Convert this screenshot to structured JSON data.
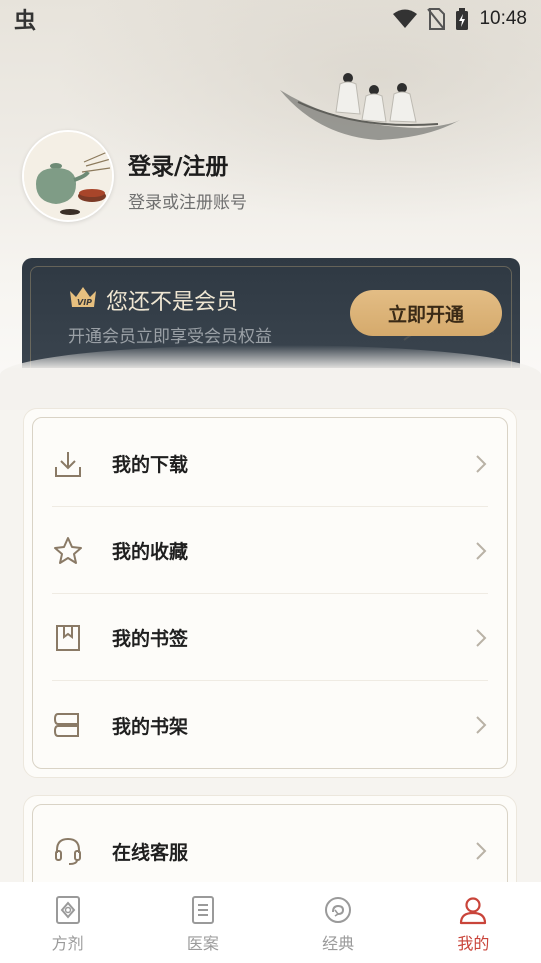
{
  "status_bar": {
    "logo": "虫",
    "time": "10:48"
  },
  "profile": {
    "title": "登录/注册",
    "subtitle": "登录或注册账号"
  },
  "vip": {
    "badge": "VIP",
    "title": "您还不是会员",
    "subtitle": "开通会员立即享受会员权益",
    "button": "立即开通"
  },
  "menu": {
    "items": [
      {
        "label": "我的下载",
        "icon": "download-icon"
      },
      {
        "label": "我的收藏",
        "icon": "star-icon"
      },
      {
        "label": "我的书签",
        "icon": "bookmark-icon"
      },
      {
        "label": "我的书架",
        "icon": "bookshelf-icon"
      }
    ],
    "service": {
      "label": "在线客服",
      "icon": "headset-icon"
    }
  },
  "bottom_nav": {
    "items": [
      {
        "label": "方剂",
        "icon": "prescription-icon",
        "active": false
      },
      {
        "label": "医案",
        "icon": "document-icon",
        "active": false
      },
      {
        "label": "经典",
        "icon": "classics-icon",
        "active": false
      },
      {
        "label": "我的",
        "icon": "person-icon",
        "active": true
      }
    ]
  },
  "colors": {
    "accent": "#c9443a",
    "gold": "#d9b077",
    "vip_bg": "#333d47"
  }
}
